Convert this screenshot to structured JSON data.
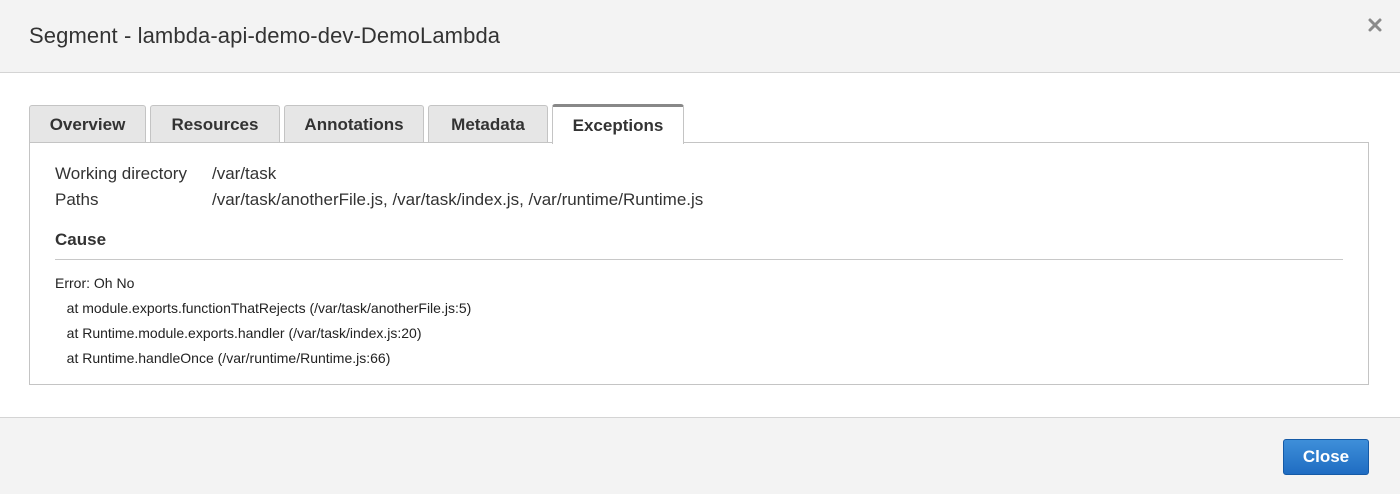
{
  "modal": {
    "title": "Segment - lambda-api-demo-dev-DemoLambda",
    "close_icon": "close-x-icon"
  },
  "tabs": [
    {
      "label": "Overview",
      "active": false
    },
    {
      "label": "Resources",
      "active": false
    },
    {
      "label": "Annotations",
      "active": false
    },
    {
      "label": "Metadata",
      "active": false
    },
    {
      "label": "Exceptions",
      "active": true
    }
  ],
  "exceptions": {
    "working_directory_label": "Working directory",
    "working_directory_value": "/var/task",
    "paths_label": "Paths",
    "paths_value": "/var/task/anotherFile.js, /var/task/index.js, /var/runtime/Runtime.js",
    "cause_heading": "Cause",
    "stack_trace": [
      "Error: Oh No",
      "   at module.exports.functionThatRejects (/var/task/anotherFile.js:5)",
      "   at Runtime.module.exports.handler (/var/task/index.js:20)",
      "   at Runtime.handleOnce (/var/runtime/Runtime.js:66)"
    ]
  },
  "footer": {
    "close_label": "Close",
    "close_color": "#1f6cc2"
  }
}
